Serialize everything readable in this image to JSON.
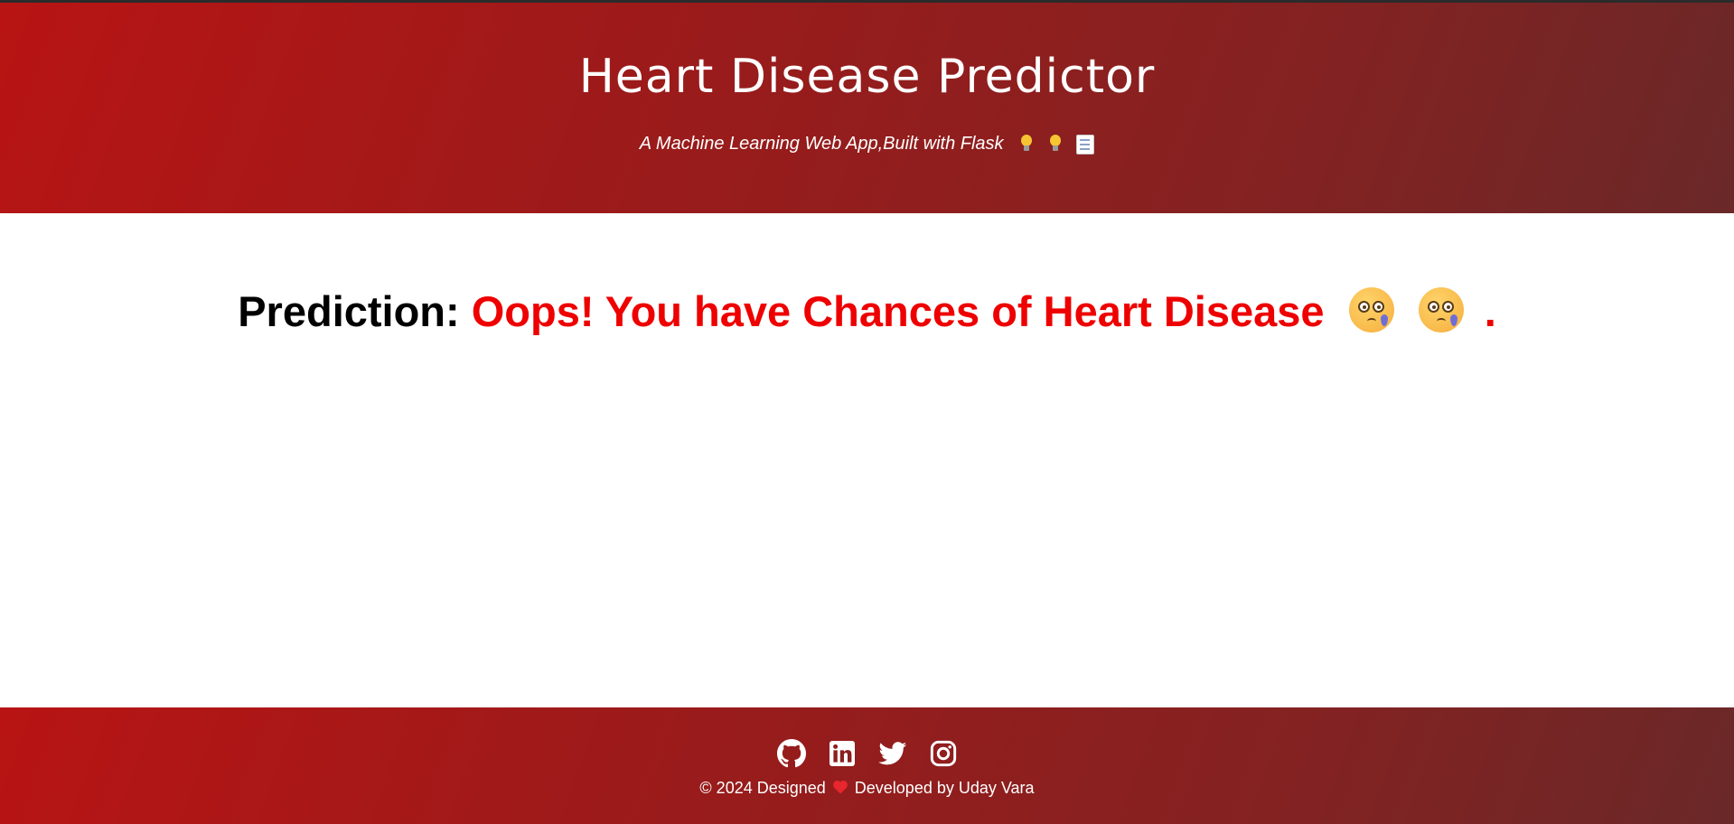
{
  "header": {
    "title": "Heart Disease Predictor",
    "subtitle": "A Machine Learning Web App,Built with Flask",
    "subtitle_icons": [
      "light-bulb-icon",
      "light-bulb-icon",
      "memo-icon"
    ]
  },
  "main": {
    "prediction_label": "Prediction:",
    "prediction_result": "Oops! You have Chances of Heart Disease",
    "result_icons": [
      "crying-face-icon",
      "crying-face-icon"
    ],
    "trailing_period": "."
  },
  "footer": {
    "social_icons": [
      "github-icon",
      "linkedin-icon",
      "twitter-icon",
      "instagram-icon"
    ],
    "copyright_prefix": "© 2024 Designed",
    "copyright_suffix": "Developed by Uday Vara",
    "heart_icon": "red-heart-icon"
  },
  "colors": {
    "header_gradient_start": "#b81414",
    "header_gradient_end": "#6a2828",
    "prediction_label": "#000000",
    "prediction_result": "#ee0000",
    "footer_text": "#ffffff"
  }
}
